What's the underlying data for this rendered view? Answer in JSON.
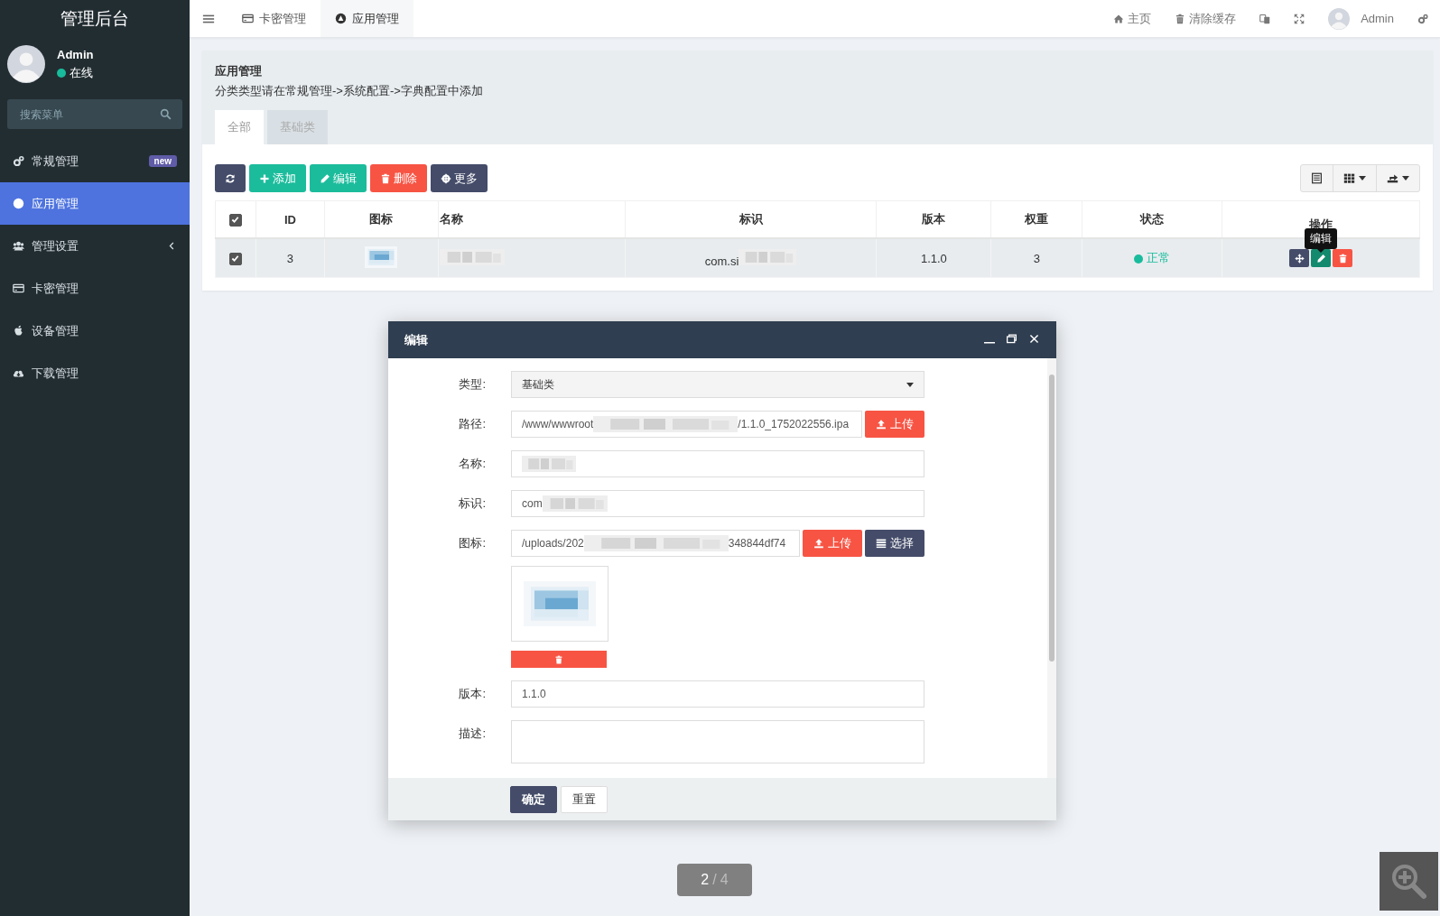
{
  "sidebar": {
    "title": "管理后台",
    "user": {
      "name": "Admin",
      "status": "在线",
      "online": true
    },
    "search": {
      "placeholder": "搜索菜单"
    },
    "items": [
      {
        "label": "常规管理",
        "badge": "new",
        "selected": false,
        "expandable": false
      },
      {
        "label": "应用管理",
        "selected": true,
        "expandable": false
      },
      {
        "label": "管理设置",
        "selected": false,
        "expandable": true
      },
      {
        "label": "卡密管理",
        "selected": false,
        "expandable": false
      },
      {
        "label": "设备管理",
        "selected": false,
        "expandable": false
      },
      {
        "label": "下载管理",
        "selected": false,
        "expandable": false
      }
    ]
  },
  "topbar": {
    "tabs": [
      {
        "label": "卡密管理",
        "selected": false
      },
      {
        "label": "应用管理",
        "selected": true
      }
    ],
    "links": [
      {
        "label": "主页"
      },
      {
        "label": "清除缓存"
      }
    ],
    "user": {
      "name": "Admin"
    }
  },
  "panel": {
    "title": "应用管理",
    "description": "分类类型请在常规管理->系统配置->字典配置中添加",
    "tabs": [
      {
        "label": "全部",
        "selected": true
      },
      {
        "label": "基础类",
        "selected": false
      }
    ],
    "toolbar": [
      {
        "color": "#444c69"
      },
      {
        "label": "添加",
        "color": "#1bbc9c"
      },
      {
        "label": "编辑",
        "color": "#1bbc9c"
      },
      {
        "label": "删除",
        "color": "#f75444"
      },
      {
        "label": "更多",
        "color": "#444c69"
      }
    ],
    "table": {
      "header_checked": true,
      "columns": [
        "ID",
        "图标",
        "名称",
        "标识",
        "版本",
        "权重",
        "状态",
        "操作"
      ],
      "rows": [
        {
          "checked": true,
          "id": "3",
          "icon": {
            "kind": "picture"
          },
          "name": {
            "redacted": true
          },
          "identifier": {
            "value": "com.si",
            "redacted": true
          },
          "version": "1.1.0",
          "weight": "3",
          "status": {
            "label": "正常",
            "color": "#18bc9c"
          },
          "actions": [
            {
              "color": "#444c69"
            },
            {
              "color": "#138a6e"
            },
            {
              "color": "#f75444"
            }
          ]
        }
      ],
      "tooltip": "编辑"
    }
  },
  "dialog": {
    "title": "编辑",
    "fields": [
      {
        "kind": "select",
        "label": "类型:",
        "value": "基础类"
      },
      {
        "kind": "upload",
        "label": "路径:",
        "value": "/www/wwwroot",
        "redacted": true,
        "value_tail": "/1.1.0_1752022556.ipa",
        "buttons": [
          {
            "kind": "upload",
            "label": "上传",
            "color": "#f75444"
          }
        ]
      },
      {
        "kind": "text",
        "label": "名称:",
        "redacted": true
      },
      {
        "kind": "text",
        "label": "标识:",
        "value": "com",
        "redacted": true
      },
      {
        "kind": "upload",
        "label": "图标:",
        "value": "/uploads/202",
        "redacted": true,
        "value_tail": "348844df74",
        "buttons": [
          {
            "kind": "upload",
            "label": "上传",
            "color": "#f75444"
          },
          {
            "kind": "choose",
            "label": "选择",
            "color": "#444c69"
          }
        ],
        "preview": {
          "kind": "picture"
        }
      },
      {
        "kind": "text",
        "label": "版本:",
        "value": "1.1.0"
      },
      {
        "kind": "textarea",
        "label": "描述:"
      }
    ],
    "buttons": [
      {
        "label": "确定",
        "primary": true
      },
      {
        "label": "重置",
        "primary": false
      }
    ]
  },
  "viewer": {
    "index": "2",
    "separator": "/",
    "total": "4"
  }
}
